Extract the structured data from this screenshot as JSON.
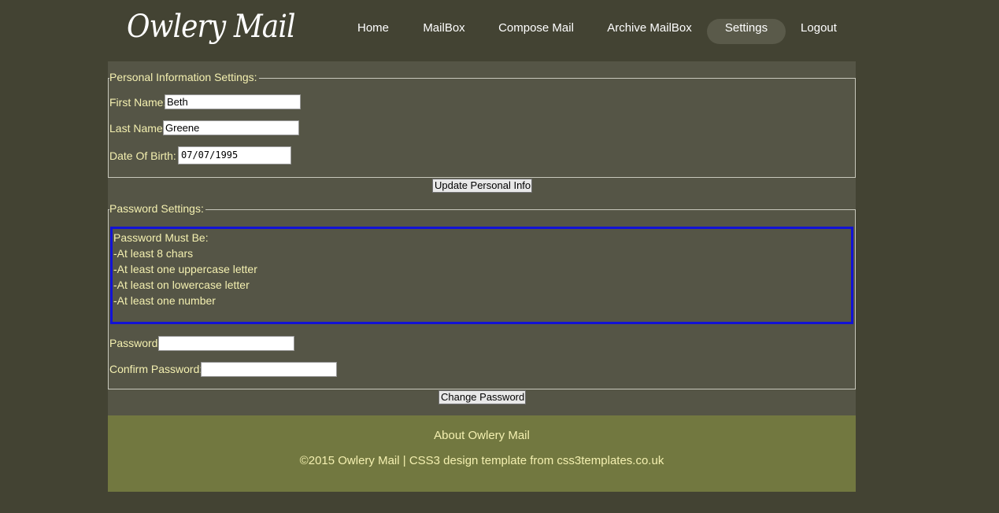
{
  "brand": {
    "logo_text": "Owlery Mail"
  },
  "nav": {
    "items": [
      {
        "label": "Home"
      },
      {
        "label": "MailBox"
      },
      {
        "label": "Compose Mail"
      },
      {
        "label": "Archive MailBox"
      },
      {
        "label": "Settings",
        "active": true
      },
      {
        "label": "Logout"
      }
    ]
  },
  "personal": {
    "legend": "Personal Information Settings:",
    "first_name_label": "First Name:",
    "first_name_value": "Beth",
    "last_name_label": "Last Name:",
    "last_name_value": "Greene",
    "dob_label": "Date Of Birth:",
    "dob_value": "07/07/1995",
    "update_button": "Update Personal Info"
  },
  "password": {
    "legend": "Password Settings:",
    "rules": [
      "Password Must Be:",
      "-At least 8 chars",
      "-At least one uppercase letter",
      "-At least on lowercase letter",
      "-At least one number"
    ],
    "password_label": "Password:",
    "password_value": "",
    "confirm_label": "Confirm Password:",
    "confirm_value": "",
    "change_button": "Change Password"
  },
  "footer": {
    "about_link": "About Owlery Mail",
    "copyright": "©2015 Owlery Mail | CSS3 design template from css3templates.co.uk"
  },
  "colors": {
    "page_bg": "#434333",
    "panel_bg": "#555546",
    "footer_bg": "#727840",
    "text": "#f4f0b0",
    "rules_border": "#1212d6",
    "active_nav_bg": "#5a5a4a"
  }
}
